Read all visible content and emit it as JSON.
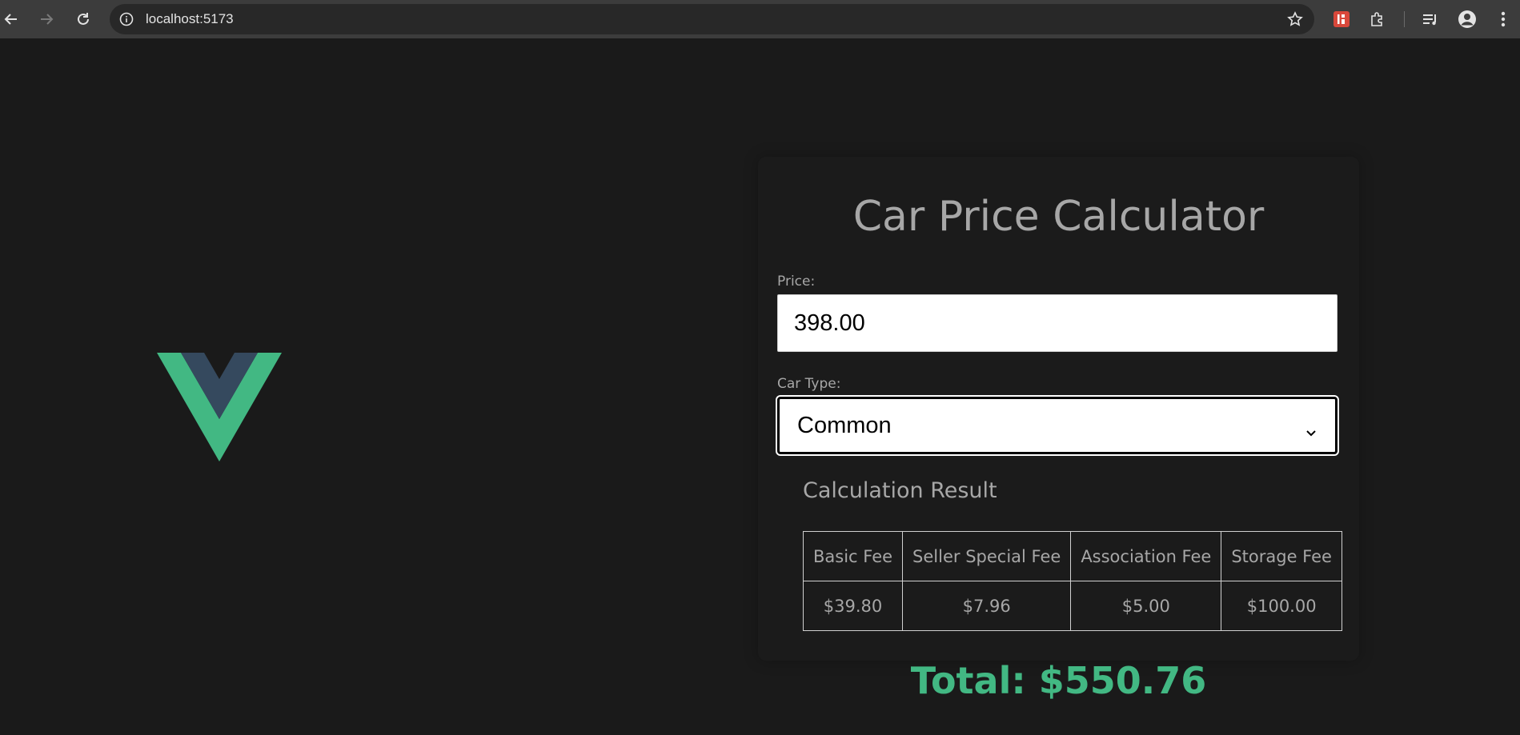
{
  "browser": {
    "url": "localhost:5173",
    "icons": [
      "back-arrow-icon",
      "forward-arrow-icon",
      "reload-icon",
      "site-info-icon",
      "bookmark-star-icon",
      "extension-red-icon",
      "extensions-puzzle-icon",
      "media-queue-icon",
      "profile-icon",
      "menu-dots-icon"
    ]
  },
  "colors": {
    "background": "#1a1a1a",
    "accent": "#42b883",
    "logo_dark": "#35495e",
    "text": "#a7a7a7"
  },
  "calculator": {
    "title": "Car Price Calculator",
    "price_label": "Price:",
    "price_value": "398.00",
    "car_type_label": "Car Type:",
    "car_type_selected": "Common",
    "result_heading": "Calculation Result",
    "table": {
      "headers": [
        "Basic Fee",
        "Seller Special Fee",
        "Association Fee",
        "Storage Fee"
      ],
      "values": [
        "$39.80",
        "$7.96",
        "$5.00",
        "$100.00"
      ]
    },
    "total": "Total: $550.76"
  }
}
